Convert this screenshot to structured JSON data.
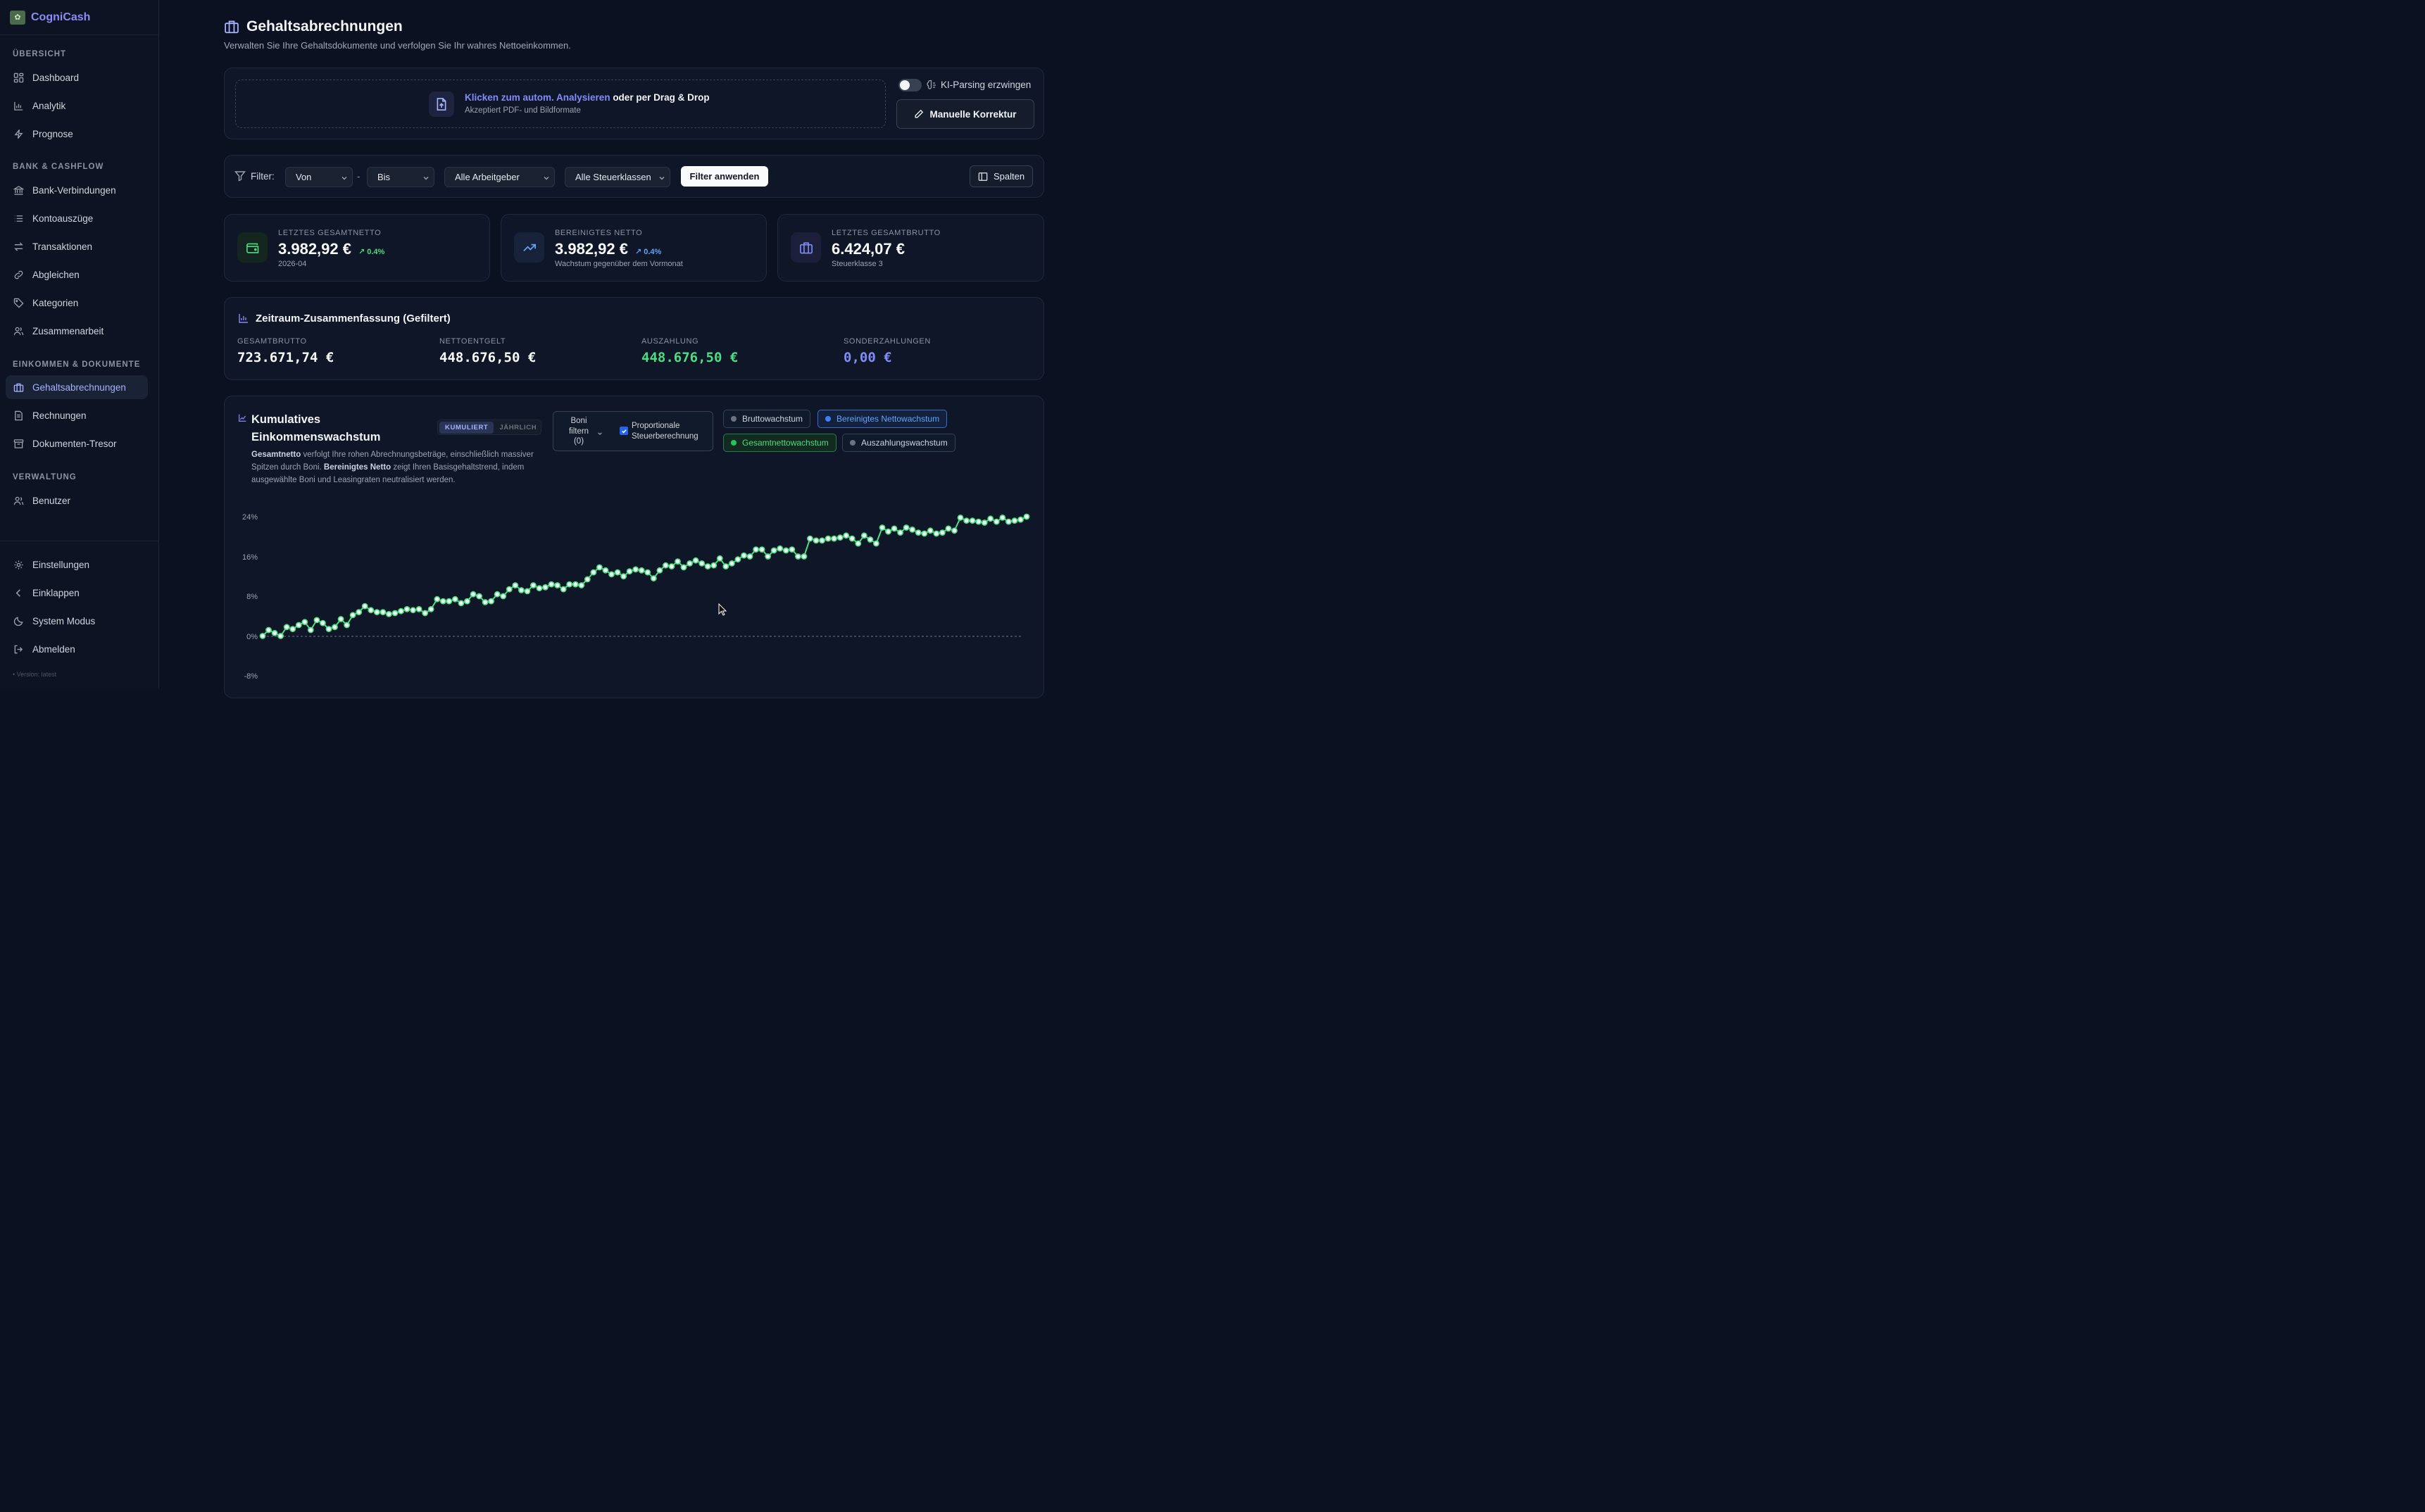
{
  "app": {
    "name": "CogniCash",
    "version": "• Version: latest"
  },
  "sidebar": {
    "sections": [
      "ÜBERSICHT",
      "BANK & CASHFLOW",
      "EINKOMMEN & DOKUMENTE",
      "VERWALTUNG"
    ],
    "items": [
      {
        "label": "Dashboard",
        "icon": "dashboard-icon"
      },
      {
        "label": "Analytik",
        "icon": "bar-chart-icon"
      },
      {
        "label": "Prognose",
        "icon": "lightning-icon"
      },
      {
        "label": "Bank-Verbindungen",
        "icon": "bank-icon"
      },
      {
        "label": "Kontoauszüge",
        "icon": "list-icon"
      },
      {
        "label": "Transaktionen",
        "icon": "arrows-icon"
      },
      {
        "label": "Abgleichen",
        "icon": "link-icon"
      },
      {
        "label": "Kategorien",
        "icon": "tag-icon"
      },
      {
        "label": "Zusammenarbeit",
        "icon": "users-icon"
      },
      {
        "label": "Gehaltsabrechnungen",
        "icon": "briefcase-icon",
        "active": true
      },
      {
        "label": "Rechnungen",
        "icon": "document-icon"
      },
      {
        "label": "Dokumenten-Tresor",
        "icon": "archive-icon"
      },
      {
        "label": "Benutzer",
        "icon": "user-icon"
      }
    ],
    "bottom": [
      {
        "label": "Einstellungen",
        "icon": "gear-icon"
      },
      {
        "label": "Einklappen",
        "icon": "chevron-left-icon"
      },
      {
        "label": "System Modus",
        "icon": "moon-icon"
      },
      {
        "label": "Abmelden",
        "icon": "logout-icon"
      }
    ]
  },
  "page": {
    "title": "Gehaltsabrechnungen",
    "subtitle": "Verwalten Sie Ihre Gehaltsdokumente und verfolgen Sie Ihr wahres Nettoeinkommen."
  },
  "upload": {
    "link": "Klicken zum autom. Analysieren",
    "rest": " oder per Drag & Drop",
    "hint": "Akzeptiert PDF- und Bildformate",
    "toggle_label": "KI-Parsing erzwingen",
    "manual_button": "Manuelle Korrektur"
  },
  "filter": {
    "label": "Filter:",
    "from": "Von",
    "dash": "-",
    "to": "Bis",
    "employer": "Alle Arbeitgeber",
    "taxclass": "Alle Steuerklassen",
    "apply": "Filter anwenden",
    "columns": "Spalten"
  },
  "kpis": [
    {
      "label": "LETZTES GESAMTNETTO",
      "value": "3.982,92 €",
      "change": "↗ 0.4%",
      "sub": "2026-04",
      "accent": "#4ade80"
    },
    {
      "label": "BEREINIGTES NETTO",
      "value": "3.982,92 €",
      "change": "↗ 0.4%",
      "sub": "Wachstum gegenüber dem Vormonat",
      "accent": "#60a5fa"
    },
    {
      "label": "LETZTES GESAMTBRUTTO",
      "value": "6.424,07 €",
      "change": "",
      "sub": "Steuerklasse 3",
      "accent": "#818cf8"
    }
  ],
  "summary": {
    "title": "Zeitraum-Zusammenfassung (Gefiltert)",
    "items": [
      {
        "label": "GESAMTBRUTTO",
        "value": "723.671,74 €",
        "color": "#f9fafb"
      },
      {
        "label": "NETTOENTGELT",
        "value": "448.676,50 €",
        "color": "#f9fafb"
      },
      {
        "label": "AUSZAHLUNG",
        "value": "448.676,50 €",
        "color": "#4ade80"
      },
      {
        "label": "SONDERZAHLUNGEN",
        "value": "0,00 €",
        "color": "#818cf8"
      }
    ]
  },
  "growth": {
    "title_line1": "Kumulatives",
    "title_line2": "Einkommenswachstum",
    "toggle_a": "KUMULIERT",
    "toggle_b": "JÄHRLICH",
    "bonus_filter": "Boni filtern (0)",
    "prop_tax": "Proportionale Steuerberechnung",
    "desc_b1": "Gesamtnetto",
    "desc_t1": " verfolgt Ihre rohen Abrechnungsbeträge, einschließlich massiver Spitzen durch Boni. ",
    "desc_b2": "Bereinigtes Netto",
    "desc_t2": " zeigt Ihren Basisgehaltstrend, indem ausgewählte Boni und Leasingraten neutralisiert werden.",
    "legend": [
      {
        "name": "Bruttowachstum",
        "active": false,
        "color": "#6b7280"
      },
      {
        "name": "Bereinigtes Nettowachstum",
        "active": true,
        "color": "#60a5fa"
      },
      {
        "name": "Gesamtnettowachstum",
        "active": true,
        "color": "#4ade80"
      },
      {
        "name": "Auszahlungswachstum",
        "active": false,
        "color": "#6b7280"
      }
    ]
  },
  "chart_data": {
    "type": "line",
    "title": "Kumulatives Einkommenswachstum",
    "y_ticks": [
      "24%",
      "16%",
      "8%",
      "0%",
      "-8%"
    ],
    "ylim": [
      -8,
      24
    ],
    "grid": false,
    "series": [
      {
        "name": "Gesamtnettowachstum",
        "color": "#4ade80",
        "values": [
          0,
          1.2,
          0.6,
          0,
          1.8,
          1.4,
          2.2,
          2.8,
          1.2,
          3.2,
          2.6,
          1.4,
          1.8,
          3.4,
          2.2,
          4.2,
          4.8,
          6.0,
          5.2,
          4.8,
          4.8,
          4.4,
          4.6,
          5.0,
          5.4,
          5.2,
          5.4,
          4.6,
          5.4,
          7.4,
          7.0,
          7.0,
          7.4,
          6.6,
          7.0,
          8.4,
          8.0,
          6.8,
          7.0,
          8.4,
          8.0,
          9.4,
          10.2,
          9.2,
          9.0,
          10.2,
          9.6,
          9.8,
          10.4,
          10.2,
          9.4,
          10.4,
          10.4,
          10.2,
          11.4,
          12.8,
          13.8,
          13.2,
          12.4,
          12.8,
          12.0,
          13.0,
          13.4,
          13.2,
          12.8,
          11.6,
          13.2,
          14.2,
          14.0,
          15.0,
          13.8,
          14.6,
          15.2,
          14.6,
          14.0,
          14.2,
          15.6,
          14.0,
          14.6,
          15.4,
          16.2,
          16.0,
          17.4,
          17.4,
          16.0,
          17.2,
          17.6,
          17.2,
          17.4,
          16.0,
          16.0,
          19.6,
          19.2,
          19.2,
          19.6,
          19.6,
          19.8,
          20.2,
          19.6,
          18.6,
          20.2,
          19.4,
          18.6,
          21.8,
          21.0,
          21.6,
          20.8,
          21.8,
          21.4,
          20.8,
          20.6,
          21.2,
          20.6,
          20.8,
          21.6,
          21.2,
          23.8,
          23.2,
          23.2,
          23.0,
          22.8,
          23.6,
          23.0,
          23.8,
          23.0,
          23.2,
          23.4,
          24.0
        ]
      }
    ]
  }
}
